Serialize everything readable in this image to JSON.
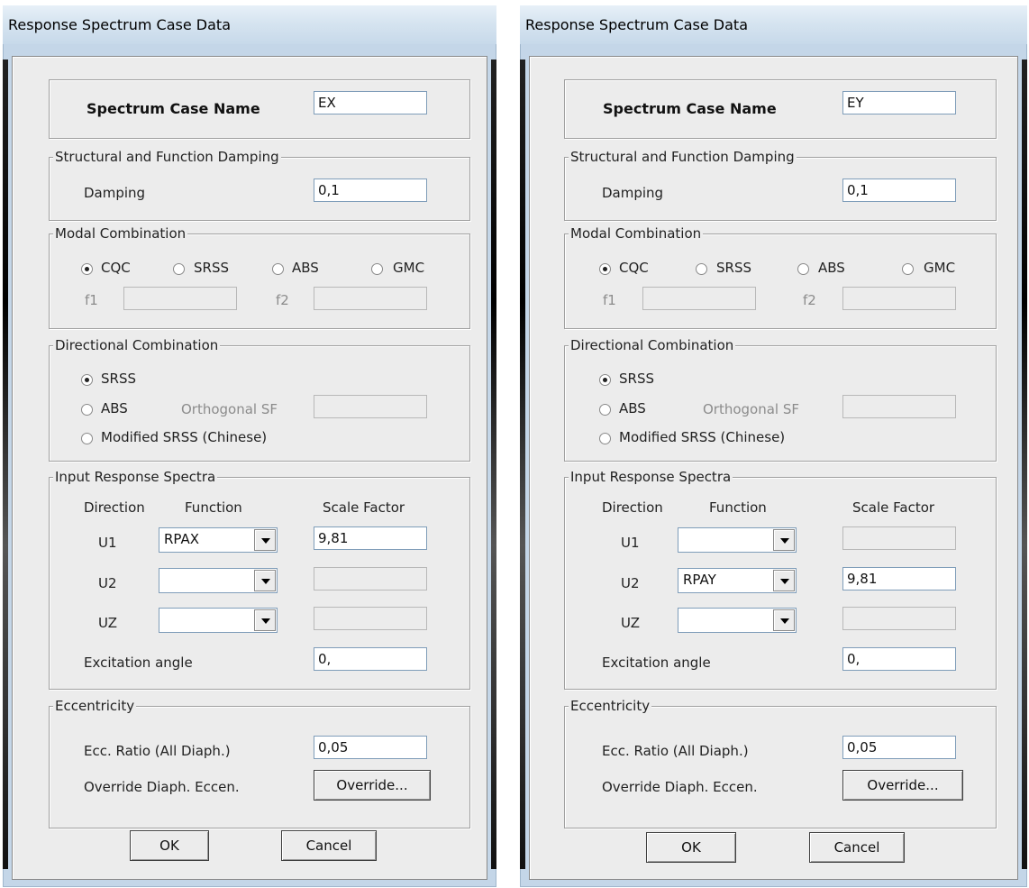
{
  "dialogs": [
    {
      "title": "Response Spectrum Case Data",
      "case_name_label": "Spectrum Case Name",
      "case_name_value": "EX",
      "damping_group": "Structural and Function Damping",
      "damping_label": "Damping",
      "damping_value": "0,1",
      "modal_group": "Modal Combination",
      "modal_options": [
        "CQC",
        "SRSS",
        "ABS",
        "GMC"
      ],
      "modal_selected": "CQC",
      "f1_label": "f1",
      "f2_label": "f2",
      "directional_group": "Directional Combination",
      "dir_opt1": "SRSS",
      "dir_opt2": "ABS",
      "dir_opt3": "Modified SRSS (Chinese)",
      "dir_selected": "SRSS",
      "ortho_label": "Orthogonal SF",
      "input_group": "Input Response Spectra",
      "col_direction": "Direction",
      "col_function": "Function",
      "col_scale": "Scale Factor",
      "rows": [
        {
          "dir": "U1",
          "func": "RPAX",
          "scale": "9,81"
        },
        {
          "dir": "U2",
          "func": "",
          "scale": ""
        },
        {
          "dir": "UZ",
          "func": "",
          "scale": ""
        }
      ],
      "excitation_label": "Excitation  angle",
      "excitation_value": "0,",
      "ecc_group": "Eccentricity",
      "ecc_ratio_label": "Ecc. Ratio (All Diaph.)",
      "ecc_ratio_value": "0,05",
      "override_label": "Override Diaph. Eccen.",
      "override_button": "Override...",
      "ok_button": "OK",
      "cancel_button": "Cancel"
    },
    {
      "title": "Response Spectrum Case Data",
      "case_name_label": "Spectrum Case Name",
      "case_name_value": "EY",
      "damping_group": "Structural and Function Damping",
      "damping_label": "Damping",
      "damping_value": "0,1",
      "modal_group": "Modal Combination",
      "modal_options": [
        "CQC",
        "SRSS",
        "ABS",
        "GMC"
      ],
      "modal_selected": "CQC",
      "f1_label": "f1",
      "f2_label": "f2",
      "directional_group": "Directional Combination",
      "dir_opt1": "SRSS",
      "dir_opt2": "ABS",
      "dir_opt3": "Modified SRSS (Chinese)",
      "dir_selected": "SRSS",
      "ortho_label": "Orthogonal SF",
      "input_group": "Input Response Spectra",
      "col_direction": "Direction",
      "col_function": "Function",
      "col_scale": "Scale Factor",
      "rows": [
        {
          "dir": "U1",
          "func": "",
          "scale": ""
        },
        {
          "dir": "U2",
          "func": "RPAY",
          "scale": "9,81"
        },
        {
          "dir": "UZ",
          "func": "",
          "scale": ""
        }
      ],
      "excitation_label": "Excitation  angle",
      "excitation_value": "0,",
      "ecc_group": "Eccentricity",
      "ecc_ratio_label": "Ecc. Ratio (All Diaph.)",
      "ecc_ratio_value": "0,05",
      "override_label": "Override Diaph. Eccen.",
      "override_button": "Override...",
      "ok_button": "OK",
      "cancel_button": "Cancel"
    }
  ]
}
